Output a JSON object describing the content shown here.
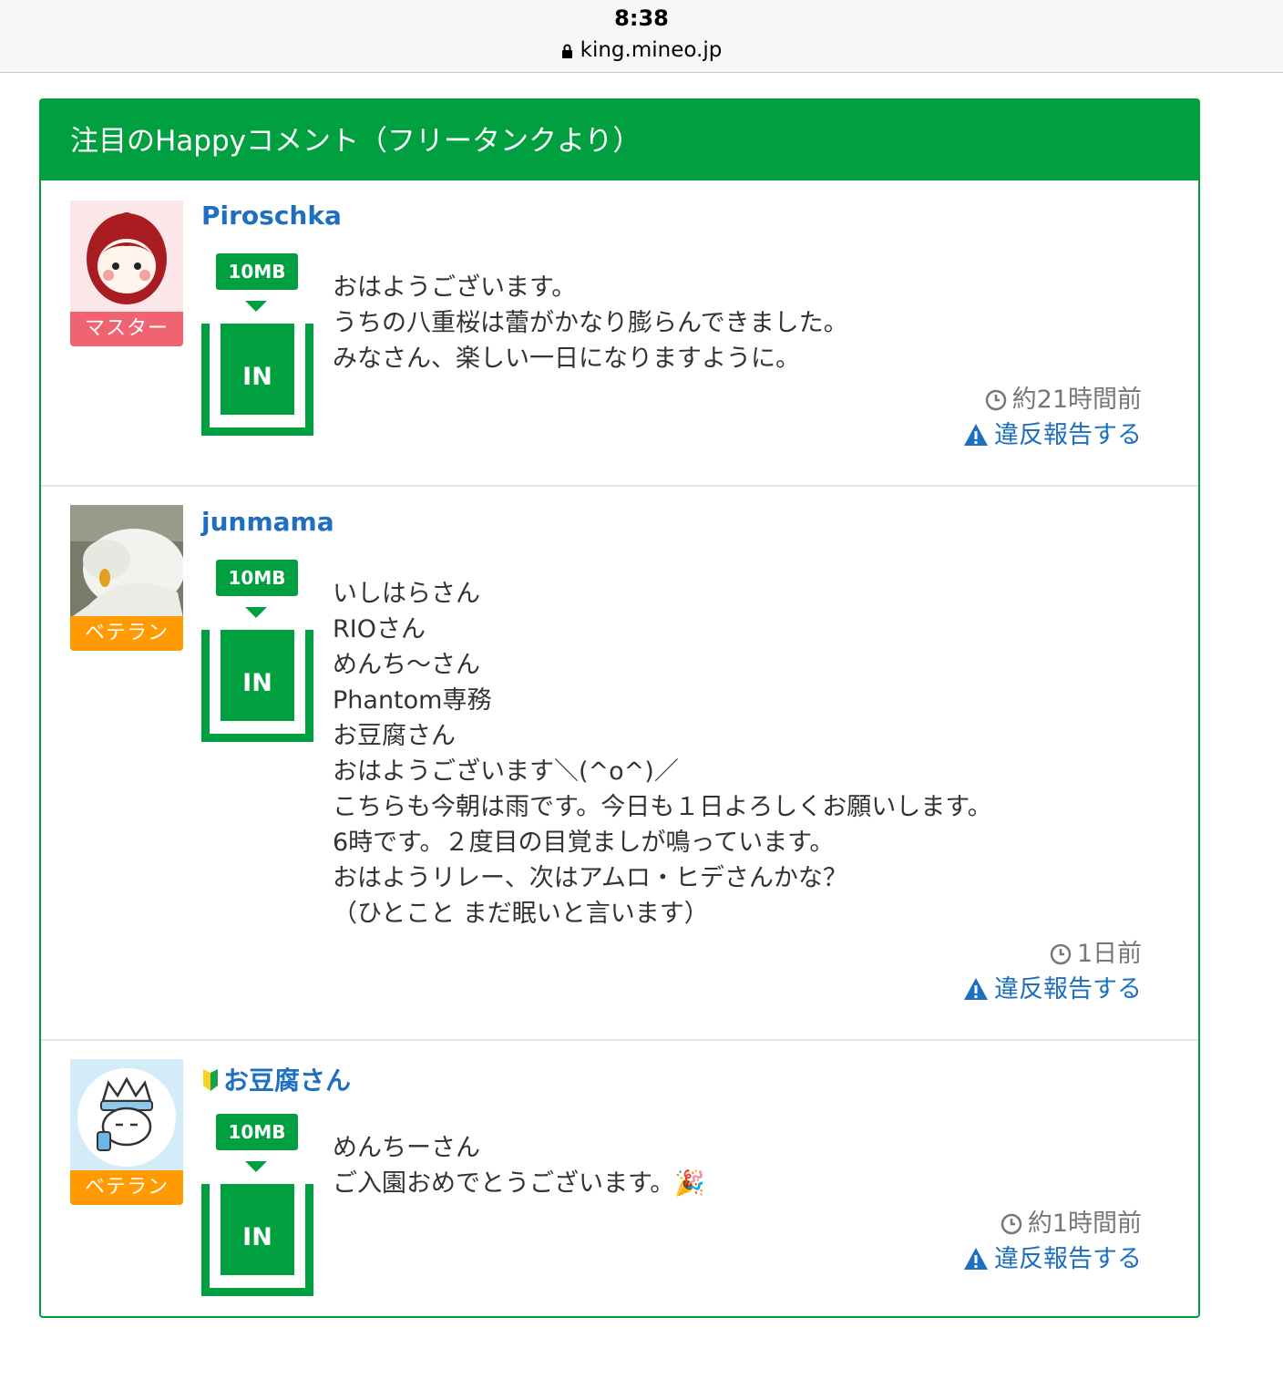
{
  "status": {
    "time": "8:38",
    "url": "king.mineo.jp"
  },
  "panel": {
    "title": "注目のHappyコメント（フリータンクより）"
  },
  "comments": [
    {
      "user": "Piroschka",
      "rank": "マスター",
      "badge_mb": "10MB",
      "direction": "IN",
      "lines": [
        "おはようございます。",
        "うちの八重桜は蕾がかなり膨らんできました。",
        "みなさん、楽しい一日になりますように。"
      ],
      "time": "約21時間前",
      "report": "違反報告する"
    },
    {
      "user": "junmama",
      "rank": "ベテラン",
      "badge_mb": "10MB",
      "direction": "IN",
      "lines": [
        "いしはらさん",
        "RIOさん",
        "めんち〜さん",
        "Phantom専務",
        "お豆腐さん",
        "おはようございます＼(^o^)／",
        "こちらも今朝は雨です。今日も１日よろしくお願いします。",
        "6時です。２度目の目覚ましが鳴っています。",
        "おはようリレー、次はアムロ・ヒデさんかな？",
        "（ひとこと まだ眠いと言います）"
      ],
      "time": "1日前",
      "report": "違反報告する"
    },
    {
      "user": "お豆腐さん",
      "rank": "ベテラン",
      "badge_mb": "10MB",
      "direction": "IN",
      "lines": [
        "めんちーさん",
        "ご入園おめでとうございます。🎉"
      ],
      "time": "約1時間前",
      "report": "違反報告する"
    }
  ]
}
